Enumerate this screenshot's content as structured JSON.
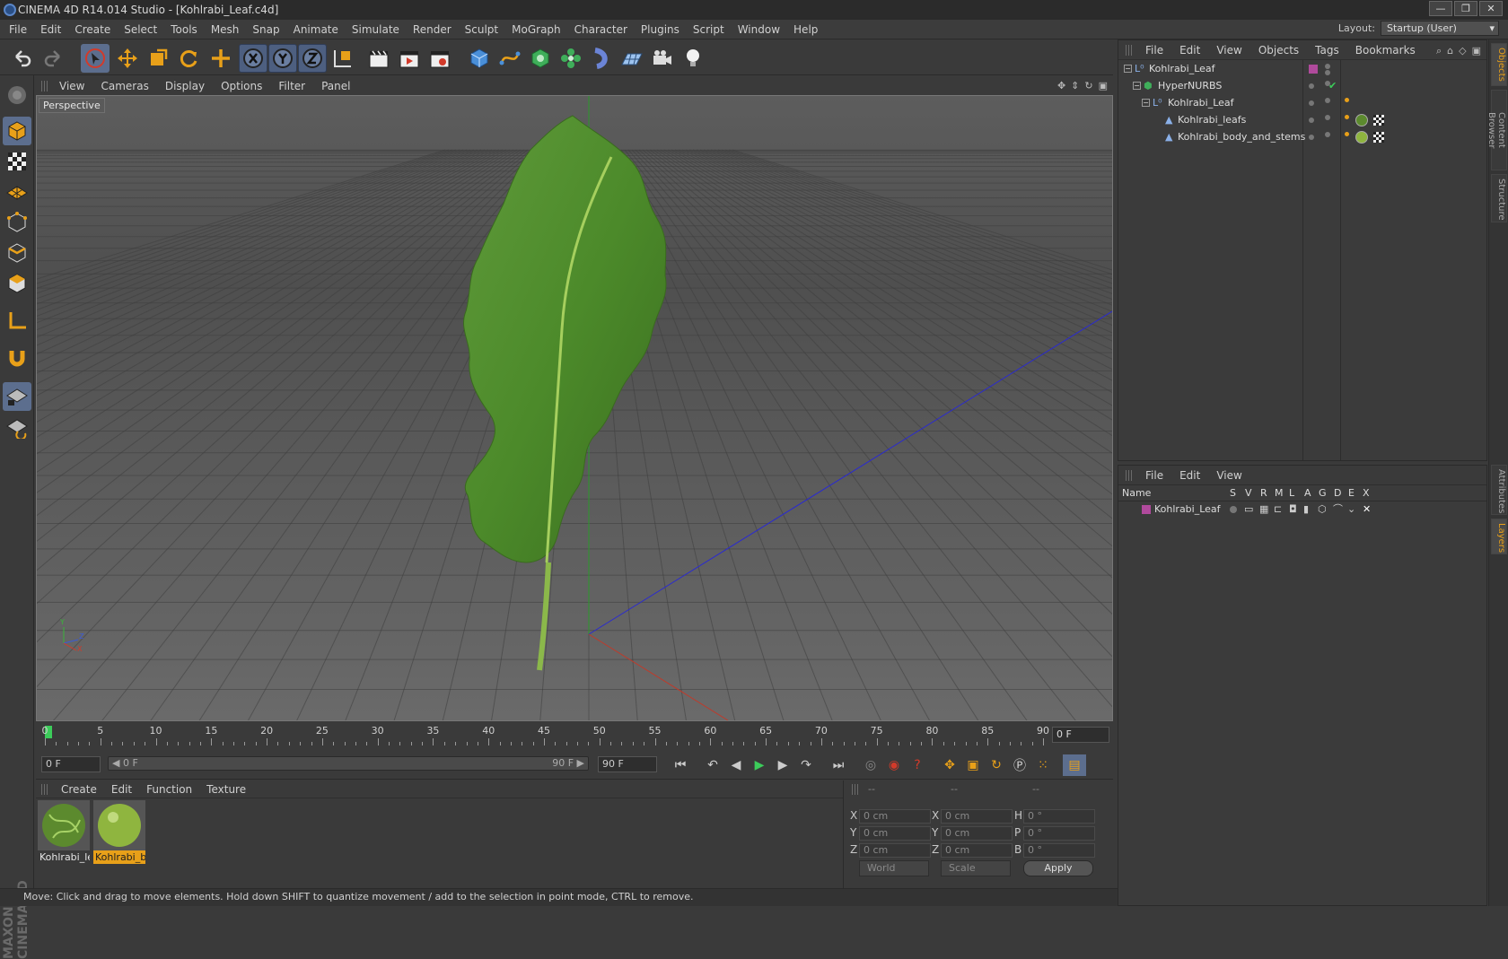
{
  "window": {
    "title": "CINEMA 4D R14.014 Studio - [Kohlrabi_Leaf.c4d]",
    "buttons": [
      "—",
      "❐",
      "✕"
    ]
  },
  "menu": [
    "File",
    "Edit",
    "Create",
    "Select",
    "Tools",
    "Mesh",
    "Snap",
    "Animate",
    "Simulate",
    "Render",
    "Sculpt",
    "MoGraph",
    "Character",
    "Plugins",
    "Script",
    "Window",
    "Help"
  ],
  "layout": {
    "label": "Layout:",
    "value": "Startup (User)"
  },
  "viewport": {
    "menu": [
      "View",
      "Cameras",
      "Display",
      "Options",
      "Filter",
      "Panel"
    ],
    "label": "Perspective",
    "axis_labels": {
      "y": "Y",
      "z": "Z",
      "x": "X"
    }
  },
  "timeline": {
    "ticks": [
      "0",
      "5",
      "10",
      "15",
      "20",
      "25",
      "30",
      "35",
      "40",
      "45",
      "50",
      "55",
      "60",
      "65",
      "70",
      "75",
      "80",
      "85",
      "90"
    ],
    "current_frame": "0 F",
    "start_field": "0 F",
    "slider_left": "◀ 0 F",
    "slider_right": "90 F ▶",
    "end_field": "90 F"
  },
  "materials": {
    "menu": [
      "Create",
      "Edit",
      "Function",
      "Texture"
    ],
    "items": [
      {
        "name": "Kohlrabi_le",
        "selected": false,
        "color": "#5c8a2e"
      },
      {
        "name": "Kohlrabi_b",
        "selected": true,
        "color": "#8fb53f"
      }
    ]
  },
  "coordinates": {
    "headers": [
      "--",
      "--",
      "--"
    ],
    "rows": [
      {
        "a": "X",
        "v1": "0 cm",
        "b": "X",
        "v2": "0 cm",
        "c": "H",
        "v3": "0 °"
      },
      {
        "a": "Y",
        "v1": "0 cm",
        "b": "Y",
        "v2": "0 cm",
        "c": "P",
        "v3": "0 °"
      },
      {
        "a": "Z",
        "v1": "0 cm",
        "b": "Z",
        "v2": "0 cm",
        "c": "B",
        "v3": "0 °"
      }
    ],
    "mode1": "World",
    "mode2": "Scale",
    "apply": "Apply"
  },
  "status": "Move: Click and drag to move elements. Hold down SHIFT to quantize movement / add to the selection in point mode, CTRL to remove.",
  "objects": {
    "menu": [
      "File",
      "Edit",
      "View",
      "Objects",
      "Tags",
      "Bookmarks"
    ],
    "rows": [
      {
        "name": "Kohlrabi_Leaf"
      },
      {
        "name": "HyperNURBS"
      },
      {
        "name": "Kohlrabi_Leaf"
      },
      {
        "name": "Kohlrabi_leafs"
      },
      {
        "name": "Kohlrabi_body_and_stems"
      }
    ]
  },
  "layers": {
    "menu": [
      "File",
      "Edit",
      "View"
    ],
    "columns": [
      "Name",
      "S",
      "V",
      "R",
      "M",
      "L",
      "A",
      "G",
      "D",
      "E",
      "X"
    ],
    "row": {
      "name": "Kohlrabi_Leaf",
      "color": "#b04a9c"
    }
  },
  "side_tabs": [
    "Objects",
    "Content Browser",
    "Structure",
    "Attributes",
    "Layers"
  ],
  "brand": "MAXON CINEMA 4D"
}
